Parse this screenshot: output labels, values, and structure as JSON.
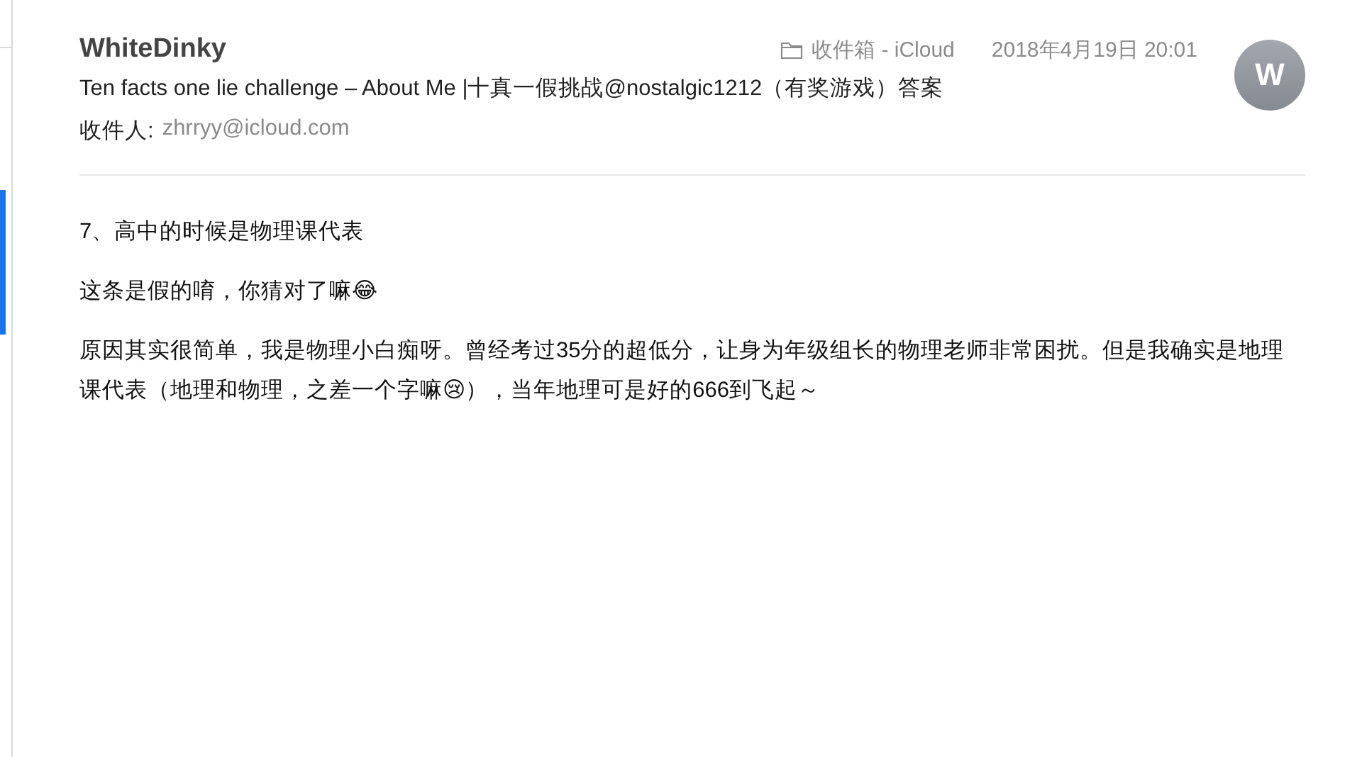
{
  "message": {
    "sender": "WhiteDinky",
    "mailbox": "收件箱 - iCloud",
    "date": "2018年4月19日 20:01",
    "avatar_initial": "W",
    "subject": "Ten facts one lie challenge – About Me |十真一假挑战@nostalgic1212（有奖游戏）答案",
    "to_label": "收件人:",
    "to_address": "zhrryy@icloud.com"
  },
  "body": [
    "7、高中的时候是物理课代表",
    "这条是假的唷，你猜对了嘛😂",
    "原因其实很简单，我是物理小白痴呀。曾经考过35分的超低分，让身为年级组长的物理老师非常困扰。但是我确实是地理课代表（地理和物理，之差一个字嘛😢），当年地理可是好的666到飞起～"
  ]
}
